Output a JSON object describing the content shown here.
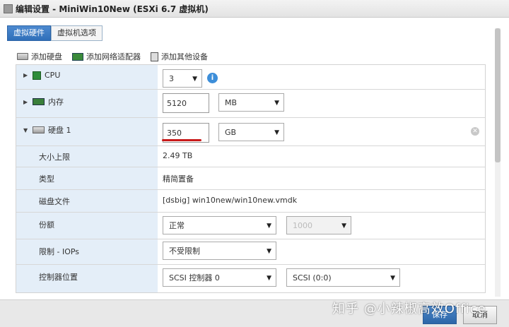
{
  "window": {
    "title": "编辑设置 - MiniWin10New (ESXi 6.7 虚拟机)"
  },
  "tabs": [
    {
      "label": "虚拟硬件"
    },
    {
      "label": "虚拟机选项"
    }
  ],
  "toolbar": {
    "add_disk": "添加硬盘",
    "add_nic": "添加网络适配器",
    "add_other": "添加其他设备"
  },
  "hardware": {
    "cpu": {
      "label": "CPU",
      "value": "3"
    },
    "memory": {
      "label": "内存",
      "value": "5120",
      "unit": "MB"
    },
    "disk": {
      "label": "硬盘 1",
      "value": "350",
      "unit": "GB",
      "max_size_label": "大小上限",
      "max_size": "2.49 TB",
      "type_label": "类型",
      "type": "精简置备",
      "file_label": "磁盘文件",
      "file": "[dsbig] win10new/win10new.vmdk",
      "shares_label": "份额",
      "shares": "正常",
      "shares_num": "1000",
      "limit_label": "限制 - IOPs",
      "limit": "不受限制",
      "controller_label": "控制器位置",
      "controller": "SCSI 控制器 0",
      "slot": "SCSI (0:0)"
    }
  },
  "footer": {
    "save": "保存",
    "cancel": "取消"
  },
  "watermark": "知乎 @小辣椒高效Office",
  "icons": {
    "info": "i",
    "clear": "✕"
  }
}
